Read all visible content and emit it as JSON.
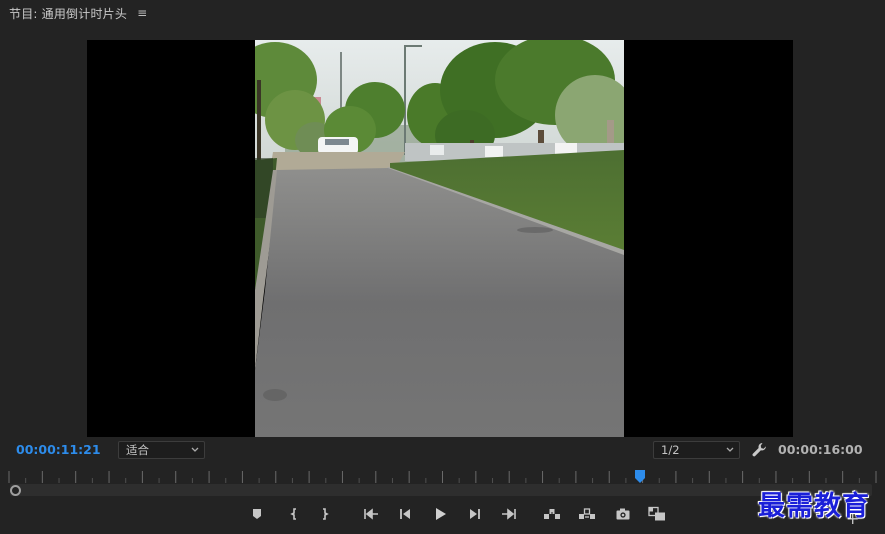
{
  "panel": {
    "title": "节目: 通用倒计时片头",
    "menu_icon": "hamburger-icon"
  },
  "monitor": {
    "program_image": "road-lined-with-trees-video-frame",
    "letterbox_color": "#000000"
  },
  "controls": {
    "current_timecode": "00:00:11:21",
    "zoom_select": {
      "value": "适合"
    },
    "resolution_select": {
      "value": "1/2"
    },
    "settings_icon": "wrench-icon",
    "duration_timecode": "00:00:16:00"
  },
  "timeline": {
    "playhead_fraction": 0.727,
    "accent_color": "#2d8ceb"
  },
  "transport_buttons": [
    {
      "icon": "add-marker-icon"
    },
    {
      "icon": "mark-in-icon"
    },
    {
      "icon": "mark-out-icon"
    },
    {
      "icon": "go-to-in-icon"
    },
    {
      "icon": "step-back-icon"
    },
    {
      "icon": "play-icon"
    },
    {
      "icon": "step-forward-icon"
    },
    {
      "icon": "go-to-out-icon"
    },
    {
      "icon": "lift-icon"
    },
    {
      "icon": "extract-icon"
    },
    {
      "icon": "export-frame-icon"
    },
    {
      "icon": "comparison-view-icon"
    }
  ],
  "watermark": {
    "text": "最需教育"
  },
  "button_editor_icon": "plus-icon"
}
